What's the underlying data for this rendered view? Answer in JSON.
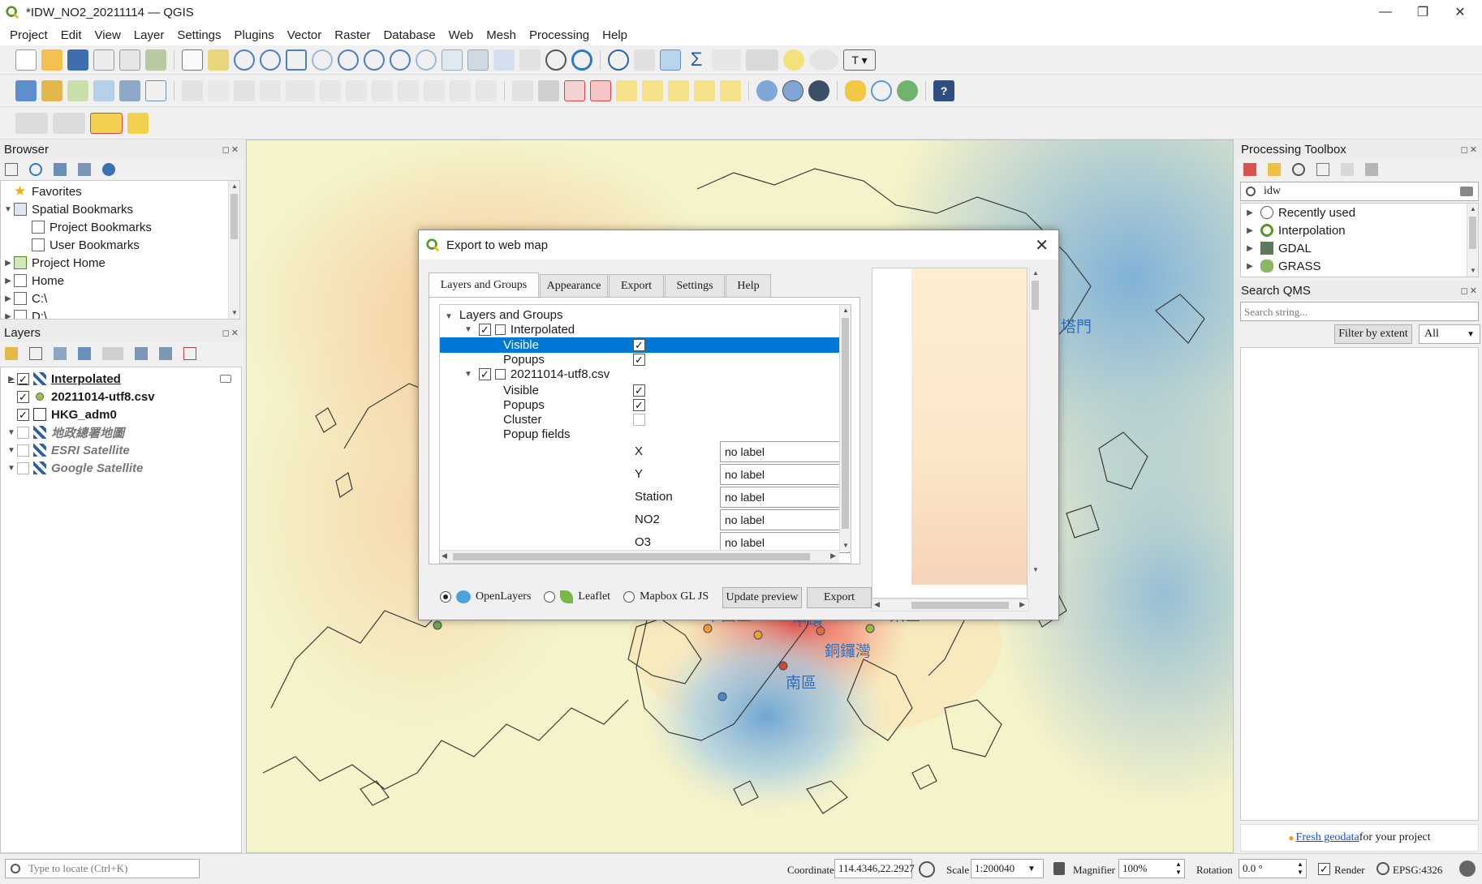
{
  "window": {
    "title": "*IDW_NO2_20211114 — QGIS",
    "minimize": "—",
    "restore": "❐",
    "close": "✕"
  },
  "menu": [
    "Project",
    "Edit",
    "View",
    "Layer",
    "Settings",
    "Plugins",
    "Vector",
    "Raster",
    "Database",
    "Web",
    "Mesh",
    "Processing",
    "Help"
  ],
  "browser": {
    "title": "Browser",
    "items": [
      {
        "label": "Favorites",
        "icon": "star-icon",
        "indent": 0,
        "arrow": ""
      },
      {
        "label": "Spatial Bookmarks",
        "icon": "bookmark-icon",
        "indent": 0,
        "arrow": "▼"
      },
      {
        "label": "Project Bookmarks",
        "icon": "folder-icon",
        "indent": 1,
        "arrow": ""
      },
      {
        "label": "User Bookmarks",
        "icon": "folder-icon",
        "indent": 1,
        "arrow": ""
      },
      {
        "label": "Project Home",
        "icon": "project-home-icon",
        "indent": 0,
        "arrow": "▶"
      },
      {
        "label": "Home",
        "icon": "home-icon",
        "indent": 0,
        "arrow": "▶"
      },
      {
        "label": "C:\\",
        "icon": "folder-icon",
        "indent": 0,
        "arrow": "▶"
      },
      {
        "label": "D:\\",
        "icon": "folder-icon",
        "indent": 0,
        "arrow": "▶"
      }
    ]
  },
  "layers": {
    "title": "Layers",
    "items": [
      {
        "label": "Interpolated",
        "checked": true,
        "style": "bold-underline",
        "arrow": "▶",
        "icon": "raster-layer-icon"
      },
      {
        "label": "20211014-utf8.csv",
        "checked": true,
        "style": "bold",
        "arrow": "",
        "icon": "point-layer-icon"
      },
      {
        "label": "HKG_adm0",
        "checked": true,
        "style": "bold",
        "arrow": "",
        "icon": "polygon-layer-icon"
      },
      {
        "label": "地政總署地圖",
        "checked": false,
        "style": "italic-gray",
        "arrow": "▼",
        "icon": "raster-layer-icon"
      },
      {
        "label": "ESRI Satellite",
        "checked": false,
        "style": "italic-gray",
        "arrow": "▼",
        "icon": "raster-layer-icon"
      },
      {
        "label": "Google Satellite",
        "checked": false,
        "style": "italic-gray",
        "arrow": "▼",
        "icon": "raster-layer-icon"
      }
    ]
  },
  "map_labels": [
    {
      "text": "塔門"
    },
    {
      "text": "中西區"
    },
    {
      "text": "中環"
    },
    {
      "text": "東區"
    },
    {
      "text": "銅鑼灣"
    },
    {
      "text": "南區"
    }
  ],
  "dialog": {
    "title": "Export to web map",
    "tabs": [
      "Layers and Groups",
      "Appearance",
      "Export",
      "Settings",
      "Help"
    ],
    "tree_root": "Layers and Groups",
    "layer1": {
      "name": "Interpolated",
      "visible": "Visible",
      "popups": "Popups"
    },
    "layer2": {
      "name": "20211014-utf8.csv",
      "visible": "Visible",
      "popups": "Popups",
      "cluster": "Cluster",
      "popup_fields": "Popup fields"
    },
    "fields": [
      {
        "name": "X",
        "value": "no label"
      },
      {
        "name": "Y",
        "value": "no label"
      },
      {
        "name": "Station",
        "value": "no label"
      },
      {
        "name": "NO2",
        "value": "no label"
      },
      {
        "name": "O3",
        "value": "no label"
      }
    ],
    "renderers": [
      "OpenLayers",
      "Leaflet",
      "Mapbox GL JS"
    ],
    "update_preview": "Update preview",
    "export": "Export"
  },
  "processing": {
    "title": "Processing Toolbox",
    "search_value": "idw",
    "items": [
      "Recently used",
      "Interpolation",
      "GDAL",
      "GRASS"
    ]
  },
  "qms": {
    "title": "Search QMS",
    "placeholder": "Search string...",
    "filter_button": "Filter by extent",
    "filter_select": "All",
    "footer_link": "Fresh geodata",
    "footer_text": " for your project"
  },
  "status": {
    "locate_placeholder": "Type to locate (Ctrl+K)",
    "coordinate_label": "Coordinate",
    "coordinate_value": "114.4346,22.2927",
    "scale_label": "Scale",
    "scale_value": "1:200040",
    "magnifier_label": "Magnifier",
    "magnifier_value": "100%",
    "rotation_label": "Rotation",
    "rotation_value": "0.0 °",
    "render_label": "Render",
    "crs": "EPSG:4326"
  },
  "colors": {
    "selection": "#0078d7",
    "accent_blue": "#3f7fbf",
    "map_label": "#2f6fb8"
  }
}
